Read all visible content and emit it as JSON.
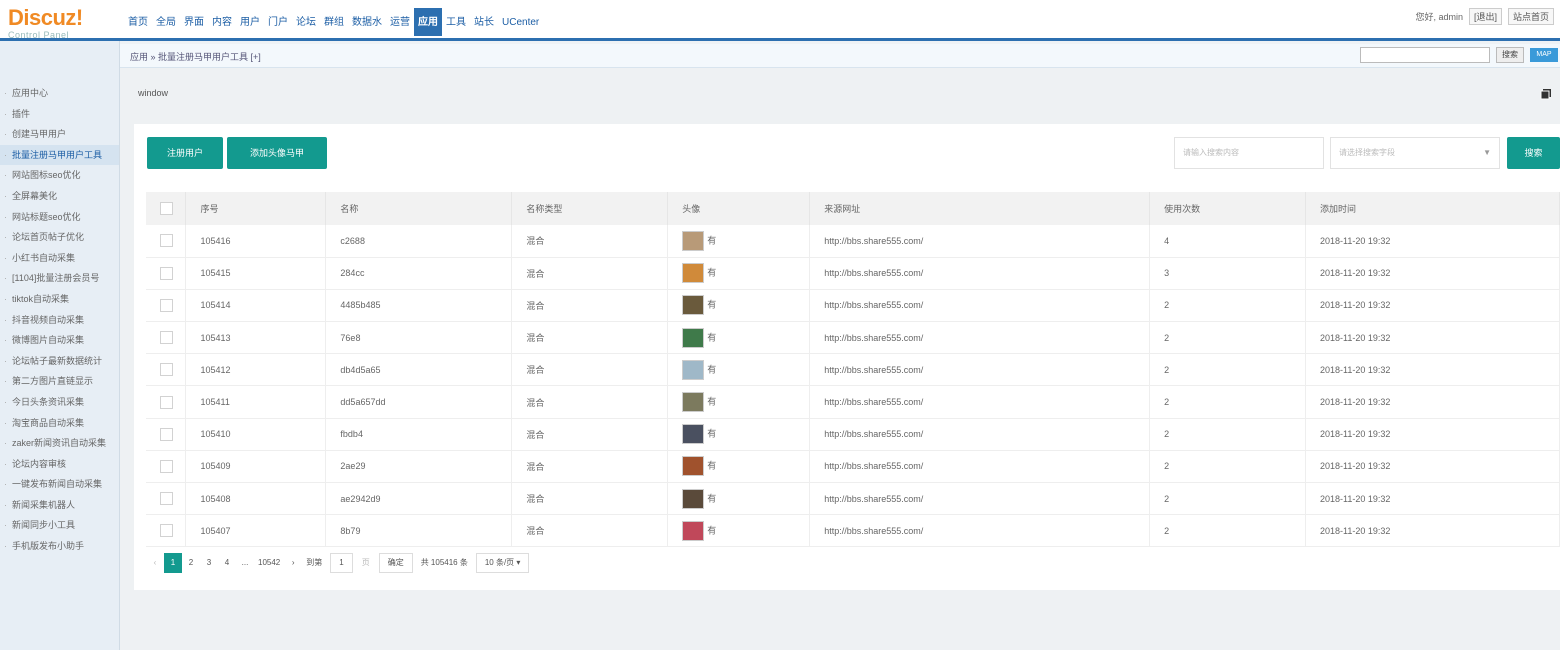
{
  "logo": {
    "main": "Discuz!",
    "sub": "Control Panel"
  },
  "nav": [
    "首页",
    "全局",
    "界面",
    "内容",
    "用户",
    "门户",
    "论坛",
    "群组",
    "数据水",
    "运营",
    "应用",
    "工具",
    "站长",
    "UCenter"
  ],
  "nav_active_index": 10,
  "top_right": {
    "greeting": "您好, admin",
    "logout": "[退出]",
    "home": "站点首页"
  },
  "breadcrumb": "应用 » 批量注册马甲用户工具  [+]",
  "search_button": "搜索",
  "map_button": "MAP",
  "sidebar": {
    "items": [
      "应用中心",
      "插件",
      "创建马甲用户",
      "批量注册马甲用户工具",
      "网站图标seo优化",
      "全屏幕美化",
      "网站标题seo优化",
      "论坛首页帖子优化",
      "小红书自动采集",
      "[1104]批量注册会员号",
      "tiktok自动采集",
      "抖音视频自动采集",
      "微博图片自动采集",
      "论坛帖子最新数据统计",
      "第二方图片直链显示",
      "今日头条资讯采集",
      "淘宝商品自动采集",
      "zaker新闻资讯自动采集",
      "论坛内容审核",
      "一键发布新闻自动采集",
      "新闻采集机器人",
      "新闻同步小工具",
      "手机版发布小助手"
    ],
    "active_index": 3
  },
  "window_label": "window",
  "buttons": {
    "register": "注册用户",
    "add_avatar": "添加头像马甲"
  },
  "filters": {
    "keyword_placeholder": "请输入搜索内容",
    "field_placeholder": "请选择搜索字段",
    "search": "搜索"
  },
  "table": {
    "headers": [
      "",
      "序号",
      "名称",
      "名称类型",
      "头像",
      "来源网址",
      "使用次数",
      "添加时间"
    ],
    "rows": [
      {
        "id": "105416",
        "name": "c2688",
        "type": "混合",
        "avatar": "有",
        "url": "http://bbs.share555.com/",
        "uses": "4",
        "time": "2018-11-20 19:32",
        "avatar_color": "#b89a78"
      },
      {
        "id": "105415",
        "name": "284cc",
        "type": "混合",
        "avatar": "有",
        "url": "http://bbs.share555.com/",
        "uses": "3",
        "time": "2018-11-20 19:32",
        "avatar_color": "#d08a3a"
      },
      {
        "id": "105414",
        "name": "4485b485",
        "type": "混合",
        "avatar": "有",
        "url": "http://bbs.share555.com/",
        "uses": "2",
        "time": "2018-11-20 19:32",
        "avatar_color": "#6a5a3c"
      },
      {
        "id": "105413",
        "name": "76e8",
        "type": "混合",
        "avatar": "有",
        "url": "http://bbs.share555.com/",
        "uses": "2",
        "time": "2018-11-20 19:32",
        "avatar_color": "#3f7a4a"
      },
      {
        "id": "105412",
        "name": "db4d5a65",
        "type": "混合",
        "avatar": "有",
        "url": "http://bbs.share555.com/",
        "uses": "2",
        "time": "2018-11-20 19:32",
        "avatar_color": "#9fb8c8"
      },
      {
        "id": "105411",
        "name": "dd5a657dd",
        "type": "混合",
        "avatar": "有",
        "url": "http://bbs.share555.com/",
        "uses": "2",
        "time": "2018-11-20 19:32",
        "avatar_color": "#7c7a5e"
      },
      {
        "id": "105410",
        "name": "fbdb4",
        "type": "混合",
        "avatar": "有",
        "url": "http://bbs.share555.com/",
        "uses": "2",
        "time": "2018-11-20 19:32",
        "avatar_color": "#4a5060"
      },
      {
        "id": "105409",
        "name": "2ae29",
        "type": "混合",
        "avatar": "有",
        "url": "http://bbs.share555.com/",
        "uses": "2",
        "time": "2018-11-20 19:32",
        "avatar_color": "#a0522d"
      },
      {
        "id": "105408",
        "name": "ae2942d9",
        "type": "混合",
        "avatar": "有",
        "url": "http://bbs.share555.com/",
        "uses": "2",
        "time": "2018-11-20 19:32",
        "avatar_color": "#5a4a3a"
      },
      {
        "id": "105407",
        "name": "8b79",
        "type": "混合",
        "avatar": "有",
        "url": "http://bbs.share555.com/",
        "uses": "2",
        "time": "2018-11-20 19:32",
        "avatar_color": "#c0485a"
      }
    ]
  },
  "pagination": {
    "prev": "‹",
    "pages": [
      "1",
      "2",
      "3",
      "4",
      "...",
      "10542"
    ],
    "next": "›",
    "goto_label": "到第",
    "goto_value": "1",
    "page_unit": "页",
    "confirm": "确定",
    "total": "共 105416 条",
    "per_page": "10 条/页 ▾"
  }
}
